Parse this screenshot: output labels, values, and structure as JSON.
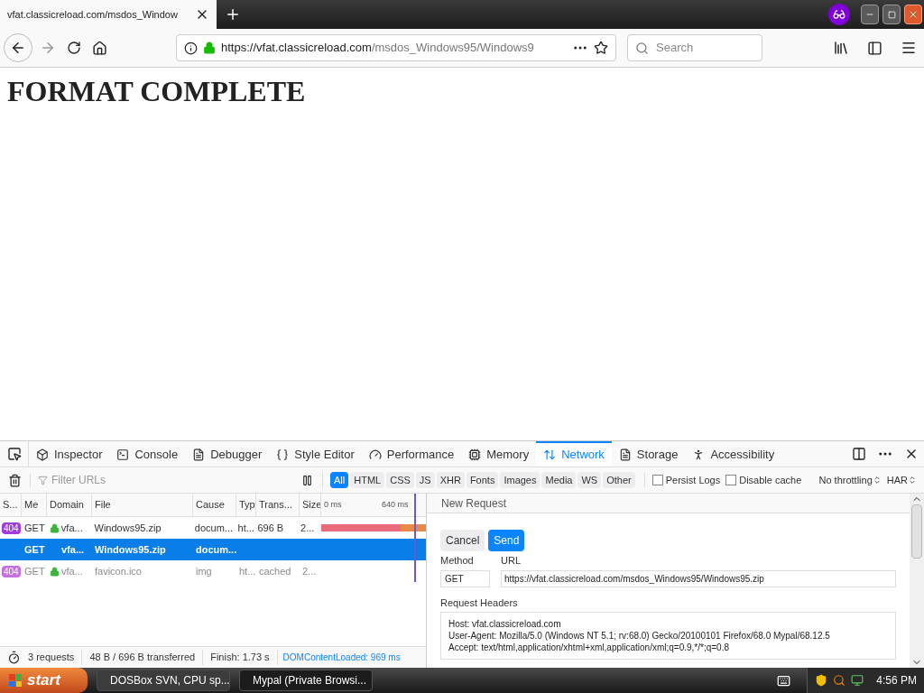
{
  "browser": {
    "tab_title": "vfat.classicreload.com/msdos_Window",
    "url_host": "https://vfat.classicreload.com",
    "url_path": "/msdos_Windows95/Windows9",
    "search_placeholder": "Search"
  },
  "page": {
    "heading": "FORMAT COMPLETE"
  },
  "devtools": {
    "tools": [
      {
        "label": "Inspector",
        "selected": false
      },
      {
        "label": "Console",
        "selected": false
      },
      {
        "label": "Debugger",
        "selected": false
      },
      {
        "label": "Style Editor",
        "selected": false
      },
      {
        "label": "Performance",
        "selected": false
      },
      {
        "label": "Memory",
        "selected": false
      },
      {
        "label": "Network",
        "selected": true
      },
      {
        "label": "Storage",
        "selected": false
      },
      {
        "label": "Accessibility",
        "selected": false
      }
    ],
    "filter_placeholder": "Filter URLs",
    "type_filters": [
      {
        "label": "All",
        "selected": true
      },
      {
        "label": "HTML",
        "selected": false
      },
      {
        "label": "CSS",
        "selected": false
      },
      {
        "label": "JS",
        "selected": false
      },
      {
        "label": "XHR",
        "selected": false
      },
      {
        "label": "Fonts",
        "selected": false
      },
      {
        "label": "Images",
        "selected": false
      },
      {
        "label": "Media",
        "selected": false
      },
      {
        "label": "WS",
        "selected": false
      },
      {
        "label": "Other",
        "selected": false
      }
    ],
    "options": [
      {
        "label": "Persist Logs",
        "checked": false
      },
      {
        "label": "Disable cache",
        "checked": false
      }
    ],
    "throttling": "No throttling",
    "har": "HAR",
    "columns": [
      "S...",
      "Me",
      "Domain",
      "File",
      "Cause",
      "Typ",
      "Trans...",
      "Size"
    ],
    "timeline_ticks": [
      "0 ms",
      "640 ms"
    ],
    "rows": [
      {
        "status": "404",
        "method": "GET",
        "secure": true,
        "domain": "vfa...",
        "file": "Windows95.zip",
        "cause": "docum...",
        "type": "ht...",
        "transferred": "696 B",
        "size": "2...",
        "selected": false,
        "faded": false,
        "waterfall": true
      },
      {
        "method": "GET",
        "secure": false,
        "domain": "vfa...",
        "file": "Windows95.zip",
        "cause": "docum...",
        "selected": true,
        "faded": false,
        "waterfall": false
      },
      {
        "status": "404",
        "method": "GET",
        "secure": true,
        "domain": "vfa...",
        "file": "favicon.ico",
        "cause": "img",
        "type": "ht...",
        "transferred": "cached",
        "size": "2...",
        "selected": false,
        "faded": true,
        "waterfall": false
      }
    ],
    "summary": {
      "requests": "3 requests",
      "transferred": "48 B / 696 B transferred",
      "finish": "Finish: 1.73 s",
      "dom_loaded": "DOMContentLoaded: 969 ms"
    },
    "new_request": {
      "title": "New Request",
      "cancel": "Cancel",
      "send": "Send",
      "method_label": "Method",
      "method": "GET",
      "url_label": "URL",
      "url": "https://vfat.classicreload.com/msdos_Windows95/Windows95.zip",
      "headers_label": "Request Headers",
      "headers": [
        "Host: vfat.classicreload.com",
        "User-Agent: Mozilla/5.0 (Windows NT 5.1; rv:68.0) Gecko/20100101 Firefox/68.0 Mypal/68.12.5",
        "Accept: text/html,application/xhtml+xml,application/xml;q=0.9,*/*;q=0.8"
      ]
    }
  },
  "taskbar": {
    "start": "start",
    "tasks": [
      {
        "label": "DOSBox SVN, CPU sp...",
        "selected": false
      },
      {
        "label": "Mypal (Private Browsi...",
        "selected": true
      }
    ],
    "clock": "4:56 PM"
  }
}
